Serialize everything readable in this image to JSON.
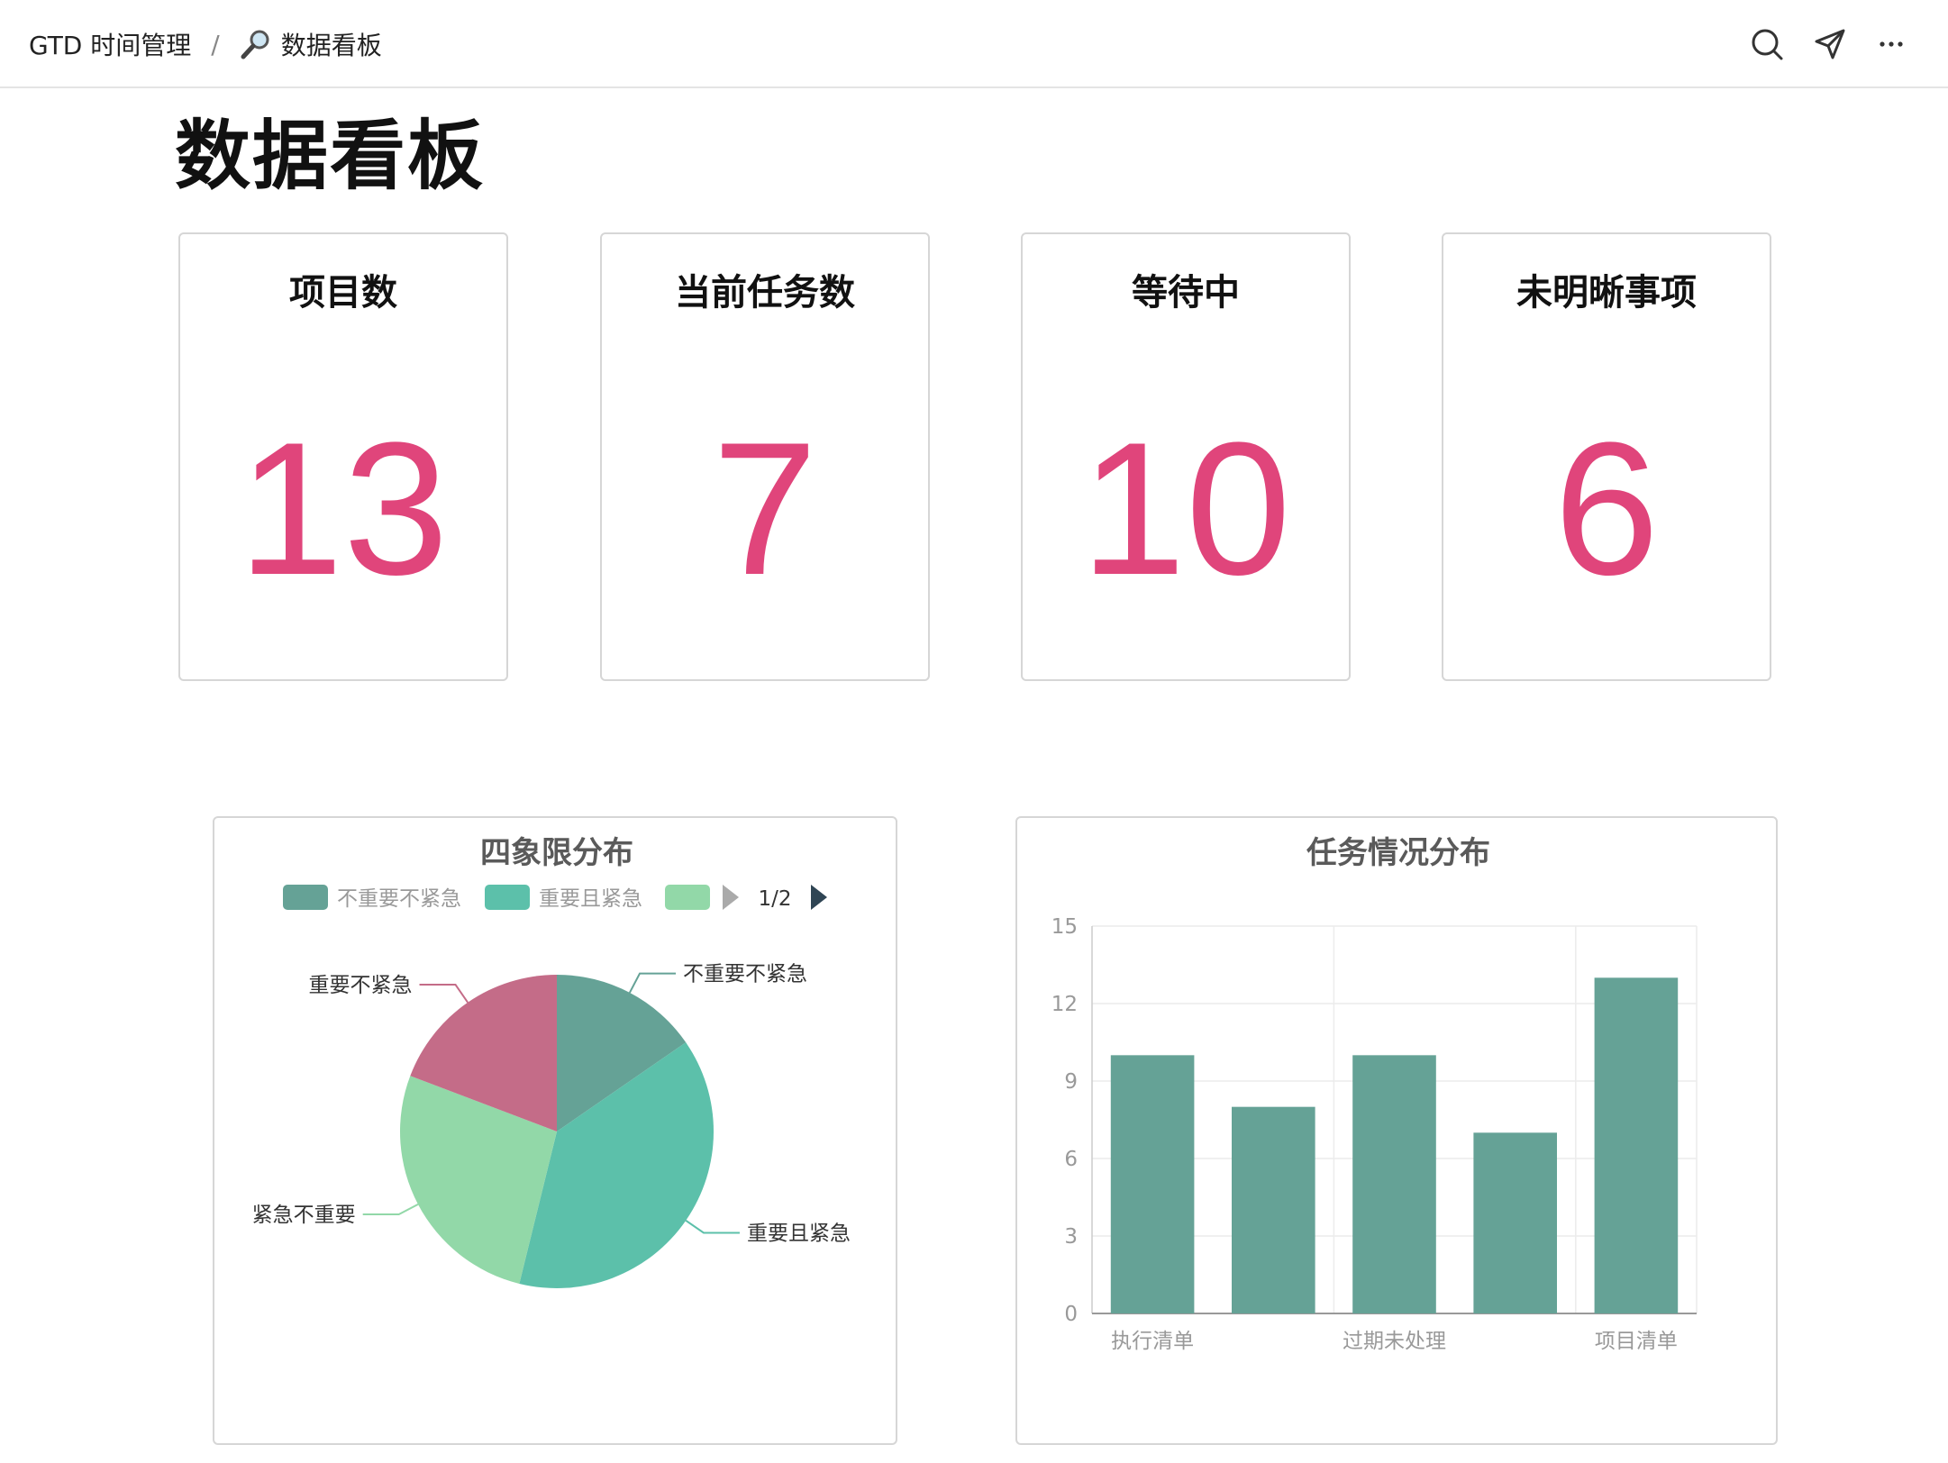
{
  "breadcrumb": {
    "root": "GTD 时间管理",
    "separator": "/",
    "current": "数据看板"
  },
  "page_title": "数据看板",
  "stats": [
    {
      "label": "项目数",
      "value": "13"
    },
    {
      "label": "当前任务数",
      "value": "7"
    },
    {
      "label": "等待中",
      "value": "10"
    },
    {
      "label": "未明晰事项",
      "value": "6"
    }
  ],
  "colors": {
    "accent": "#e0457b",
    "teal_dark": "#65a296",
    "teal": "#5cc0aa",
    "green_light": "#92d8a8",
    "rose": "#c46c88"
  },
  "chart_data": [
    {
      "type": "pie",
      "title": "四象限分布",
      "legend": {
        "items": [
          "不重要不紧急",
          "重要且紧急",
          ""
        ],
        "page": "1/2",
        "placement": "top"
      },
      "slices": [
        {
          "label": "不重要不紧急",
          "value": 2,
          "color": "#65a296"
        },
        {
          "label": "重要且紧急",
          "value": 5,
          "color": "#5cc0aa"
        },
        {
          "label": "紧急不重要",
          "value": 3.5,
          "color": "#92d8a8"
        },
        {
          "label": "重要不紧急",
          "value": 2.5,
          "color": "#c46c88"
        }
      ]
    },
    {
      "type": "bar",
      "title": "任务情况分布",
      "categories": [
        "执行清单",
        "",
        "过期未处理",
        "",
        "项目清单"
      ],
      "values": [
        10,
        8,
        10,
        7,
        13
      ],
      "ylim": [
        0,
        15
      ],
      "yticks": [
        "0",
        "3",
        "6",
        "9",
        "12",
        "15"
      ],
      "grid": true,
      "color": "#65a296"
    }
  ]
}
